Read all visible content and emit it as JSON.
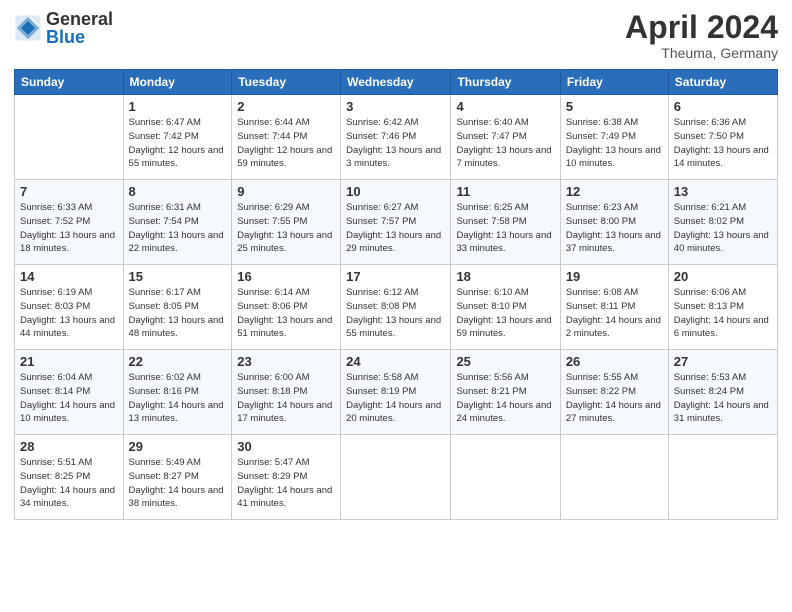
{
  "header": {
    "logo": {
      "general": "General",
      "blue": "Blue"
    },
    "title": "April 2024",
    "location": "Theuma, Germany"
  },
  "weekdays": [
    "Sunday",
    "Monday",
    "Tuesday",
    "Wednesday",
    "Thursday",
    "Friday",
    "Saturday"
  ],
  "weeks": [
    [
      {
        "day": null
      },
      {
        "day": "1",
        "sunrise": "Sunrise: 6:47 AM",
        "sunset": "Sunset: 7:42 PM",
        "daylight": "Daylight: 12 hours and 55 minutes."
      },
      {
        "day": "2",
        "sunrise": "Sunrise: 6:44 AM",
        "sunset": "Sunset: 7:44 PM",
        "daylight": "Daylight: 12 hours and 59 minutes."
      },
      {
        "day": "3",
        "sunrise": "Sunrise: 6:42 AM",
        "sunset": "Sunset: 7:46 PM",
        "daylight": "Daylight: 13 hours and 3 minutes."
      },
      {
        "day": "4",
        "sunrise": "Sunrise: 6:40 AM",
        "sunset": "Sunset: 7:47 PM",
        "daylight": "Daylight: 13 hours and 7 minutes."
      },
      {
        "day": "5",
        "sunrise": "Sunrise: 6:38 AM",
        "sunset": "Sunset: 7:49 PM",
        "daylight": "Daylight: 13 hours and 10 minutes."
      },
      {
        "day": "6",
        "sunrise": "Sunrise: 6:36 AM",
        "sunset": "Sunset: 7:50 PM",
        "daylight": "Daylight: 13 hours and 14 minutes."
      }
    ],
    [
      {
        "day": "7",
        "sunrise": "Sunrise: 6:33 AM",
        "sunset": "Sunset: 7:52 PM",
        "daylight": "Daylight: 13 hours and 18 minutes."
      },
      {
        "day": "8",
        "sunrise": "Sunrise: 6:31 AM",
        "sunset": "Sunset: 7:54 PM",
        "daylight": "Daylight: 13 hours and 22 minutes."
      },
      {
        "day": "9",
        "sunrise": "Sunrise: 6:29 AM",
        "sunset": "Sunset: 7:55 PM",
        "daylight": "Daylight: 13 hours and 25 minutes."
      },
      {
        "day": "10",
        "sunrise": "Sunrise: 6:27 AM",
        "sunset": "Sunset: 7:57 PM",
        "daylight": "Daylight: 13 hours and 29 minutes."
      },
      {
        "day": "11",
        "sunrise": "Sunrise: 6:25 AM",
        "sunset": "Sunset: 7:58 PM",
        "daylight": "Daylight: 13 hours and 33 minutes."
      },
      {
        "day": "12",
        "sunrise": "Sunrise: 6:23 AM",
        "sunset": "Sunset: 8:00 PM",
        "daylight": "Daylight: 13 hours and 37 minutes."
      },
      {
        "day": "13",
        "sunrise": "Sunrise: 6:21 AM",
        "sunset": "Sunset: 8:02 PM",
        "daylight": "Daylight: 13 hours and 40 minutes."
      }
    ],
    [
      {
        "day": "14",
        "sunrise": "Sunrise: 6:19 AM",
        "sunset": "Sunset: 8:03 PM",
        "daylight": "Daylight: 13 hours and 44 minutes."
      },
      {
        "day": "15",
        "sunrise": "Sunrise: 6:17 AM",
        "sunset": "Sunset: 8:05 PM",
        "daylight": "Daylight: 13 hours and 48 minutes."
      },
      {
        "day": "16",
        "sunrise": "Sunrise: 6:14 AM",
        "sunset": "Sunset: 8:06 PM",
        "daylight": "Daylight: 13 hours and 51 minutes."
      },
      {
        "day": "17",
        "sunrise": "Sunrise: 6:12 AM",
        "sunset": "Sunset: 8:08 PM",
        "daylight": "Daylight: 13 hours and 55 minutes."
      },
      {
        "day": "18",
        "sunrise": "Sunrise: 6:10 AM",
        "sunset": "Sunset: 8:10 PM",
        "daylight": "Daylight: 13 hours and 59 minutes."
      },
      {
        "day": "19",
        "sunrise": "Sunrise: 6:08 AM",
        "sunset": "Sunset: 8:11 PM",
        "daylight": "Daylight: 14 hours and 2 minutes."
      },
      {
        "day": "20",
        "sunrise": "Sunrise: 6:06 AM",
        "sunset": "Sunset: 8:13 PM",
        "daylight": "Daylight: 14 hours and 6 minutes."
      }
    ],
    [
      {
        "day": "21",
        "sunrise": "Sunrise: 6:04 AM",
        "sunset": "Sunset: 8:14 PM",
        "daylight": "Daylight: 14 hours and 10 minutes."
      },
      {
        "day": "22",
        "sunrise": "Sunrise: 6:02 AM",
        "sunset": "Sunset: 8:16 PM",
        "daylight": "Daylight: 14 hours and 13 minutes."
      },
      {
        "day": "23",
        "sunrise": "Sunrise: 6:00 AM",
        "sunset": "Sunset: 8:18 PM",
        "daylight": "Daylight: 14 hours and 17 minutes."
      },
      {
        "day": "24",
        "sunrise": "Sunrise: 5:58 AM",
        "sunset": "Sunset: 8:19 PM",
        "daylight": "Daylight: 14 hours and 20 minutes."
      },
      {
        "day": "25",
        "sunrise": "Sunrise: 5:56 AM",
        "sunset": "Sunset: 8:21 PM",
        "daylight": "Daylight: 14 hours and 24 minutes."
      },
      {
        "day": "26",
        "sunrise": "Sunrise: 5:55 AM",
        "sunset": "Sunset: 8:22 PM",
        "daylight": "Daylight: 14 hours and 27 minutes."
      },
      {
        "day": "27",
        "sunrise": "Sunrise: 5:53 AM",
        "sunset": "Sunset: 8:24 PM",
        "daylight": "Daylight: 14 hours and 31 minutes."
      }
    ],
    [
      {
        "day": "28",
        "sunrise": "Sunrise: 5:51 AM",
        "sunset": "Sunset: 8:25 PM",
        "daylight": "Daylight: 14 hours and 34 minutes."
      },
      {
        "day": "29",
        "sunrise": "Sunrise: 5:49 AM",
        "sunset": "Sunset: 8:27 PM",
        "daylight": "Daylight: 14 hours and 38 minutes."
      },
      {
        "day": "30",
        "sunrise": "Sunrise: 5:47 AM",
        "sunset": "Sunset: 8:29 PM",
        "daylight": "Daylight: 14 hours and 41 minutes."
      },
      {
        "day": null
      },
      {
        "day": null
      },
      {
        "day": null
      },
      {
        "day": null
      }
    ]
  ]
}
